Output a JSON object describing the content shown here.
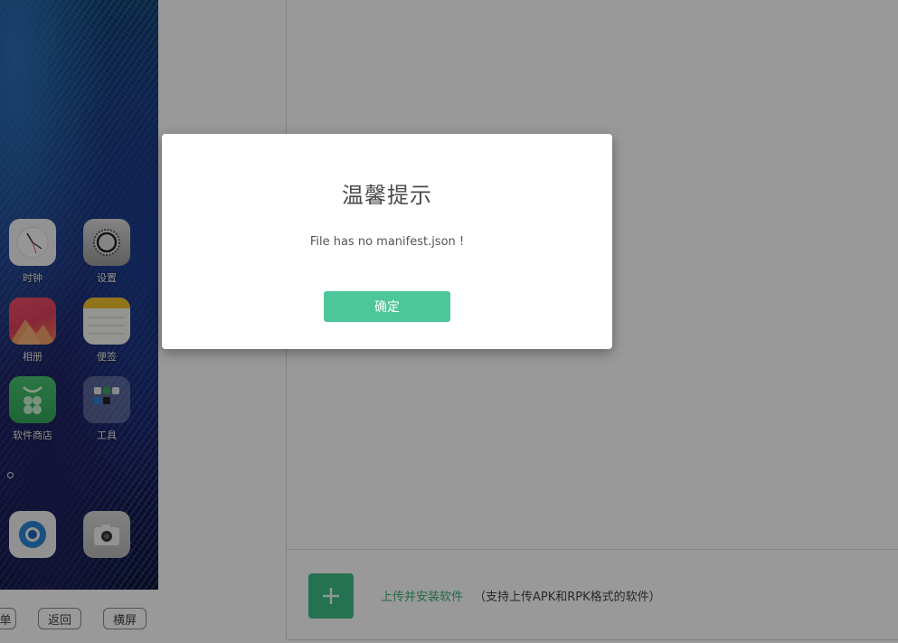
{
  "phone": {
    "apps": [
      {
        "label": "时钟",
        "icon": "clock-icon"
      },
      {
        "label": "设置",
        "icon": "settings-icon"
      },
      {
        "label": "相册",
        "icon": "photos-icon"
      },
      {
        "label": "便签",
        "icon": "notes-icon"
      },
      {
        "label": "软件商店",
        "icon": "app-store-icon"
      },
      {
        "label": "工具",
        "icon": "tools-folder-icon"
      }
    ],
    "dock": [
      {
        "icon": "browser-icon"
      },
      {
        "icon": "camera-icon"
      }
    ],
    "buttons": {
      "menu": "单",
      "back": "返回",
      "landscape": "横屏"
    }
  },
  "upload": {
    "link": "上传并安装软件",
    "hint": "（支持上传APK和RPK格式的软件）",
    "plus": "+"
  },
  "dialog": {
    "title": "温馨提示",
    "message": "File has no manifest.json !",
    "confirm": "确定"
  },
  "colors": {
    "accent": "#4cc79a",
    "overlay": "rgba(0,0,0,0.4)"
  }
}
